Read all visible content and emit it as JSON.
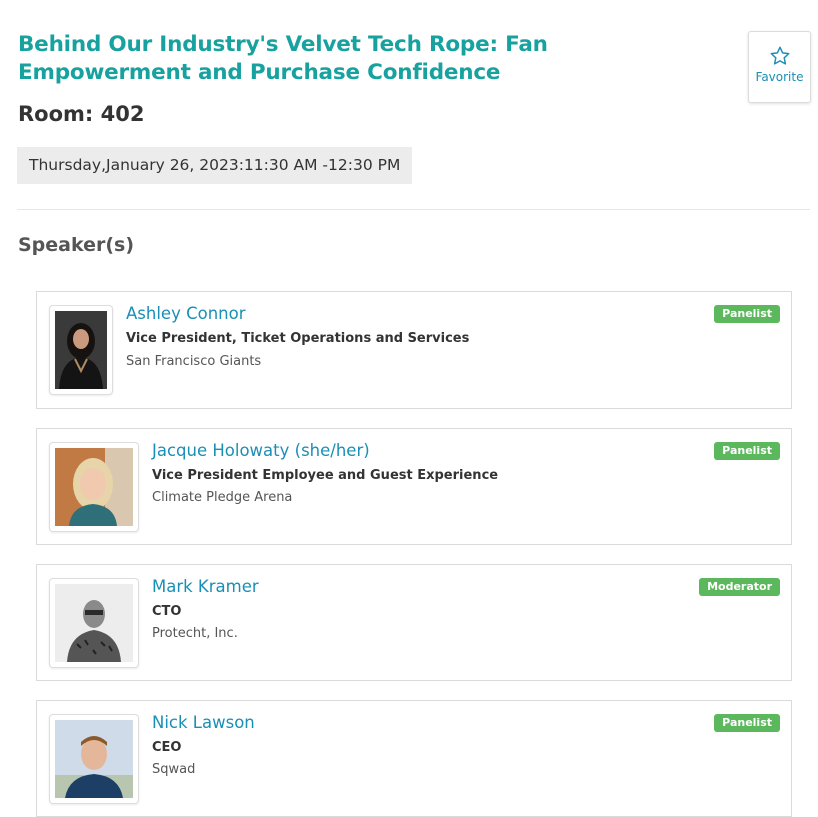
{
  "session": {
    "title": "Behind Our Industry's Velvet Tech Rope: Fan Empowerment and Purchase Confidence",
    "room": "Room: 402",
    "datetime": "Thursday,January 26, 2023:11:30 AM -12:30 PM"
  },
  "favorite": {
    "label": "Favorite",
    "icon": "star-outline-icon"
  },
  "speakers_heading": "Speaker(s)",
  "speakers": [
    {
      "name": "Ashley Connor",
      "title": "Vice President, Ticket Operations and Services",
      "org": "San Francisco Giants",
      "role": "Panelist"
    },
    {
      "name": "Jacque Holowaty (she/her)",
      "title": "Vice President Employee and Guest Experience",
      "org": "Climate Pledge Arena",
      "role": "Panelist"
    },
    {
      "name": "Mark Kramer",
      "title": "CTO",
      "org": "Protecht, Inc.",
      "role": "Moderator"
    },
    {
      "name": "Nick Lawson",
      "title": "CEO",
      "org": "Sqwad",
      "role": "Panelist"
    }
  ],
  "colors": {
    "accent": "#17a2a0",
    "link": "#1a8fb5",
    "badge": "#5cb85c"
  }
}
